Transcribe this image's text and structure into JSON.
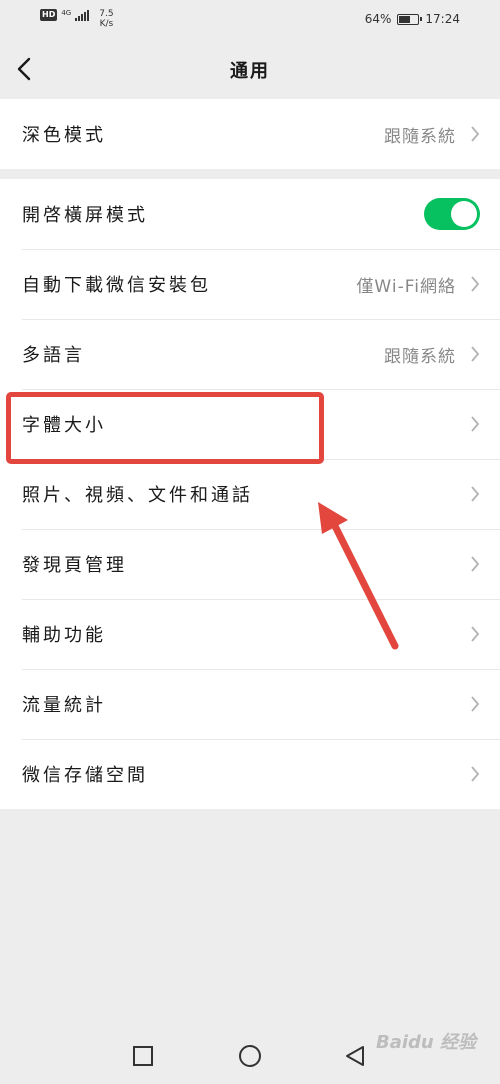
{
  "status_bar": {
    "hd": "HD",
    "network": "4G",
    "speed_value": "7.5",
    "speed_unit": "K/s",
    "battery_percent": "64%",
    "battery_level": 0.64,
    "time": "17:24"
  },
  "nav": {
    "title": "通用",
    "back_icon": "chevron-left-icon"
  },
  "group1": [
    {
      "label": "深色模式",
      "value": "跟隨系統"
    }
  ],
  "group2": [
    {
      "label": "開啓橫屏模式",
      "toggle": true
    },
    {
      "label": "自動下載微信安裝包",
      "value": "僅Wi-Fi網絡"
    },
    {
      "label": "多語言",
      "value": "跟隨系統"
    },
    {
      "label": "字體大小",
      "value": ""
    },
    {
      "label": "照片、視頻、文件和通話",
      "value": ""
    },
    {
      "label": "發現頁管理",
      "value": ""
    },
    {
      "label": "輔助功能",
      "value": ""
    },
    {
      "label": "流量統計",
      "value": ""
    },
    {
      "label": "微信存儲空間",
      "value": ""
    }
  ],
  "colors": {
    "toggle_on": "#07c160",
    "annotation": "#e2463d",
    "background": "#ededed"
  },
  "watermark": "Baidu 经验"
}
